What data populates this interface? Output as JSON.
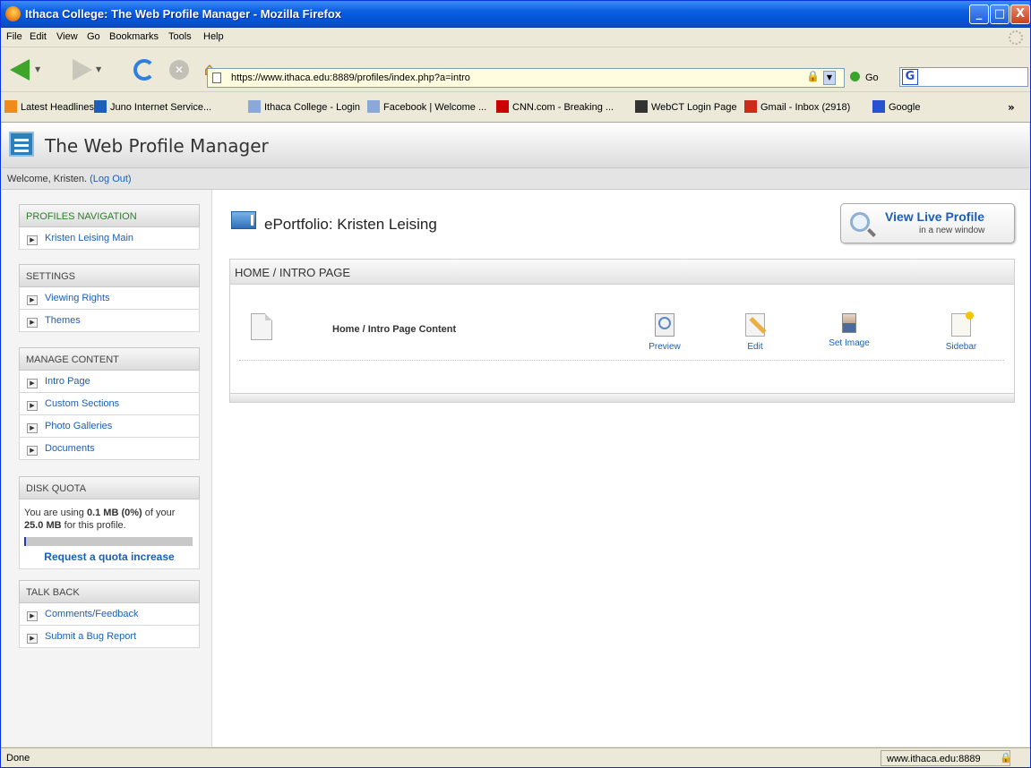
{
  "window": {
    "title": "Ithaca College: The Web Profile Manager - Mozilla Firefox",
    "controls": [
      "_",
      "□",
      "X"
    ]
  },
  "menubar": [
    "File",
    "Edit",
    "View",
    "Go",
    "Bookmarks",
    "Tools",
    "Help"
  ],
  "navbar": {
    "url": "https://www.ithaca.edu:8889/profiles/index.php?a=intro",
    "go_label": "Go",
    "search_engine_letter": "G"
  },
  "bookmarks": [
    {
      "label": "Latest Headlines",
      "icon": "rss-icon",
      "color": "#f08a1a"
    },
    {
      "label": "Juno Internet Service...",
      "icon": "juno-icon",
      "color": "#1c5fb4"
    },
    {
      "label": "Ithaca College - Login",
      "icon": "ithaca-icon",
      "color": "#8aa8d8"
    },
    {
      "label": "Facebook | Welcome ...",
      "icon": "ithaca-icon",
      "color": "#8aa8d8"
    },
    {
      "label": "CNN.com - Breaking ...",
      "icon": "cnn-icon",
      "color": "#cc0000"
    },
    {
      "label": "WebCT Login Page",
      "icon": "webct-icon",
      "color": "#333333"
    },
    {
      "label": "Gmail - Inbox (2918)",
      "icon": "gmail-icon",
      "color": "#cc2a1a"
    },
    {
      "label": "Google",
      "icon": "google-icon",
      "color": "#2850d0"
    }
  ],
  "app": {
    "title": "The Web Profile Manager",
    "welcome": "Welcome, Kristen.",
    "logout_label": "(Log Out)"
  },
  "sidebar": {
    "profiles_nav": {
      "heading": "PROFILES NAVIGATION",
      "items": [
        "Kristen Leising Main"
      ]
    },
    "settings": {
      "heading": "SETTINGS",
      "items": [
        "Viewing Rights",
        "Themes"
      ]
    },
    "manage_content": {
      "heading": "MANAGE CONTENT",
      "items": [
        "Intro Page",
        "Custom Sections",
        "Photo Galleries",
        "Documents"
      ]
    },
    "disk_quota": {
      "heading": "DISK QUOTA",
      "text_1": "You are using",
      "used": "0.1 MB (0%)",
      "text_2": "of your",
      "total": "25.0 MB",
      "text_3": "for this profile.",
      "usage_fraction": 0,
      "request_link": "Request a quota increase"
    },
    "talk_back": {
      "heading": "TALK BACK",
      "items": [
        "Comments/Feedback",
        "Submit a Bug Report"
      ]
    }
  },
  "main": {
    "title": "ePortfolio: Kristen Leising",
    "view_live": {
      "main": "View Live Profile",
      "sub": "in a new window"
    },
    "panel": {
      "heading": "HOME / INTRO PAGE",
      "row_title": "Home / Intro Page Content",
      "actions": [
        "Preview",
        "Edit",
        "Set Image",
        "Sidebar"
      ]
    }
  },
  "status": {
    "text": "Done",
    "host": "www.ithaca.edu:8889"
  }
}
